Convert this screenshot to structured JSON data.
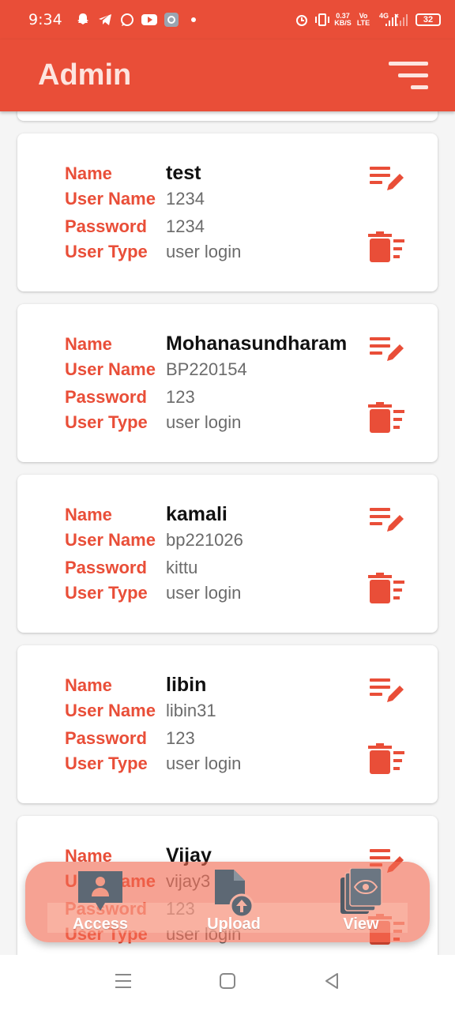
{
  "status_bar": {
    "time": "9:34",
    "net_speed_value": "0.37",
    "net_speed_unit": "KB/S",
    "volte_top": "Vo",
    "volte_bottom": "LTE",
    "network_type": "4G",
    "battery": "32"
  },
  "app_bar": {
    "title": "Admin",
    "menu_icon": "sort-menu-icon"
  },
  "labels": {
    "name": "Name",
    "username": "User Name",
    "password": "Password",
    "user_type": "User Type"
  },
  "users": [
    {
      "name": "test",
      "username": "1234",
      "password": "1234",
      "user_type": "user login"
    },
    {
      "name": "Mohanasundharam",
      "username": "BP220154",
      "password": "123",
      "user_type": "user login"
    },
    {
      "name": "kamali",
      "username": "bp221026",
      "password": "kittu",
      "user_type": "user login"
    },
    {
      "name": "libin",
      "username": "libin31",
      "password": "123",
      "user_type": "user login"
    },
    {
      "name": "Vijay",
      "username": "vijay3",
      "password": "123",
      "user_type": "user login"
    }
  ],
  "bottom_nav": {
    "items": [
      {
        "label": "Access",
        "icon": "person-badge-icon"
      },
      {
        "label": "Upload",
        "icon": "file-upload-icon"
      },
      {
        "label": "View",
        "icon": "documents-view-icon"
      }
    ]
  },
  "colors": {
    "accent": "#e94e38",
    "label": "#e94e38",
    "value": "#6b6b6b"
  }
}
